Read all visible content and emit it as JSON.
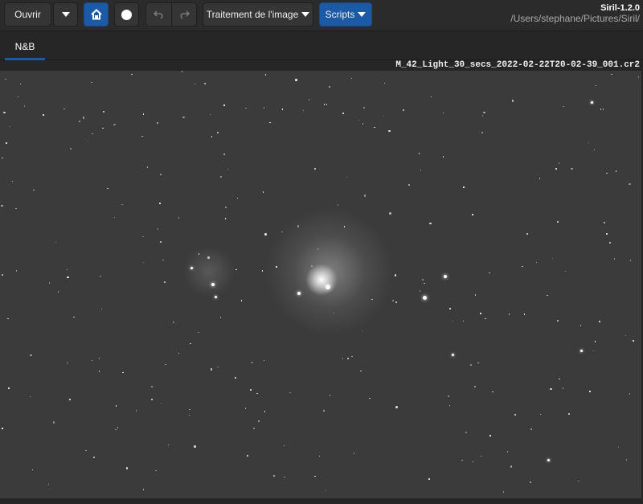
{
  "toolbar": {
    "open_label": "Ouvrir",
    "processing_label": "Traitement de l'image",
    "scripts_label": "Scripts"
  },
  "app": {
    "title": "Siril-1.2.0",
    "path": "/Users/stephane/Pictures/Siril/"
  },
  "tabs": [
    {
      "label": "N&B",
      "active": true
    }
  ],
  "image": {
    "filename": "M_42_Light_30_secs_2022-02-22T20-02-39_001.cr2"
  },
  "colors": {
    "accent": "#1d5aa6",
    "background": "#262626",
    "image_bg": "#3b3b3b"
  }
}
